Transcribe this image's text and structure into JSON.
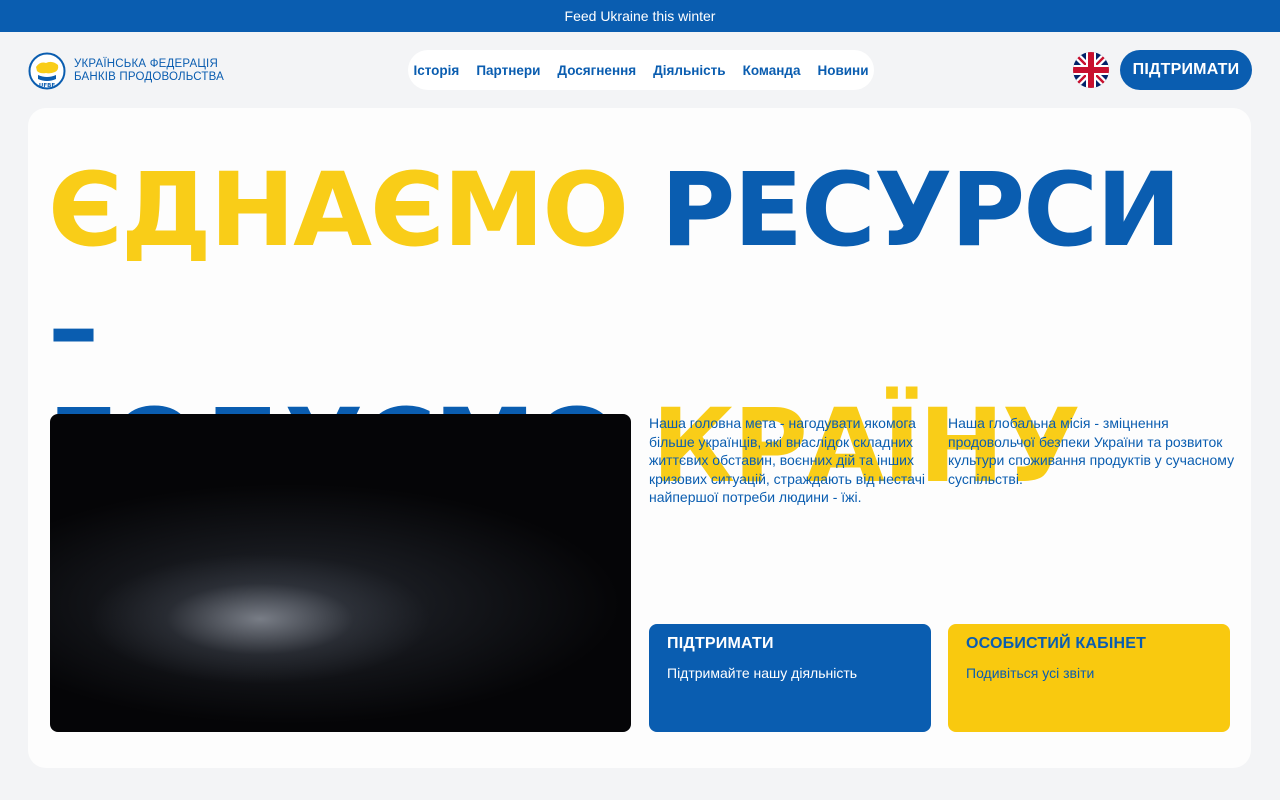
{
  "banner": {
    "text": "Feed Ukraine this winter"
  },
  "logo": {
    "line1": "УКРАЇНСЬКА ФЕДЕРАЦІЯ",
    "line2": "БАНКІВ ПРОДОВОЛЬСТВА",
    "mark_text": "UFBF",
    "icon": "ufbf-logo-icon"
  },
  "nav": {
    "items": [
      {
        "label": "Історія"
      },
      {
        "label": "Партнери"
      },
      {
        "label": "Досягнення"
      },
      {
        "label": "Діяльність"
      },
      {
        "label": "Команда"
      },
      {
        "label": "Новини"
      }
    ]
  },
  "language": {
    "icon": "uk-flag-icon"
  },
  "header": {
    "support_label": "ПІДТРИМАТИ"
  },
  "hero": {
    "line1_part1": "ЄДНАЄМО",
    "line1_part2": "РЕСУРСИ –",
    "line2_part1": "ГОДУЄМО",
    "line2_part2": "КРАЇНУ"
  },
  "main": {
    "paragraph1": "Наша головна мета - нагодувати якомога більше українців, які внаслідок складних життєвих обставин, воєнних дій та інших кризових ситуацій, страждають від нестачі найпершої потреби людини - їжі.",
    "paragraph2": "Наша глобальна місія - зміцнення продовольчої безпеки України та розвиток культури споживання продуктів у сучасному суспільстві.",
    "support_card": {
      "title": "ПІДТРИМАТИ",
      "subtitle": "Підтримайте нашу діяльність"
    },
    "cabinet_card": {
      "title": "ОСОБИСТИЙ КАБІНЕТ",
      "subtitle": "Подивіться усі звіти"
    }
  },
  "colors": {
    "brand_blue": "#0a5db0",
    "brand_yellow": "#f9cd18",
    "background": "#f3f4f6"
  }
}
